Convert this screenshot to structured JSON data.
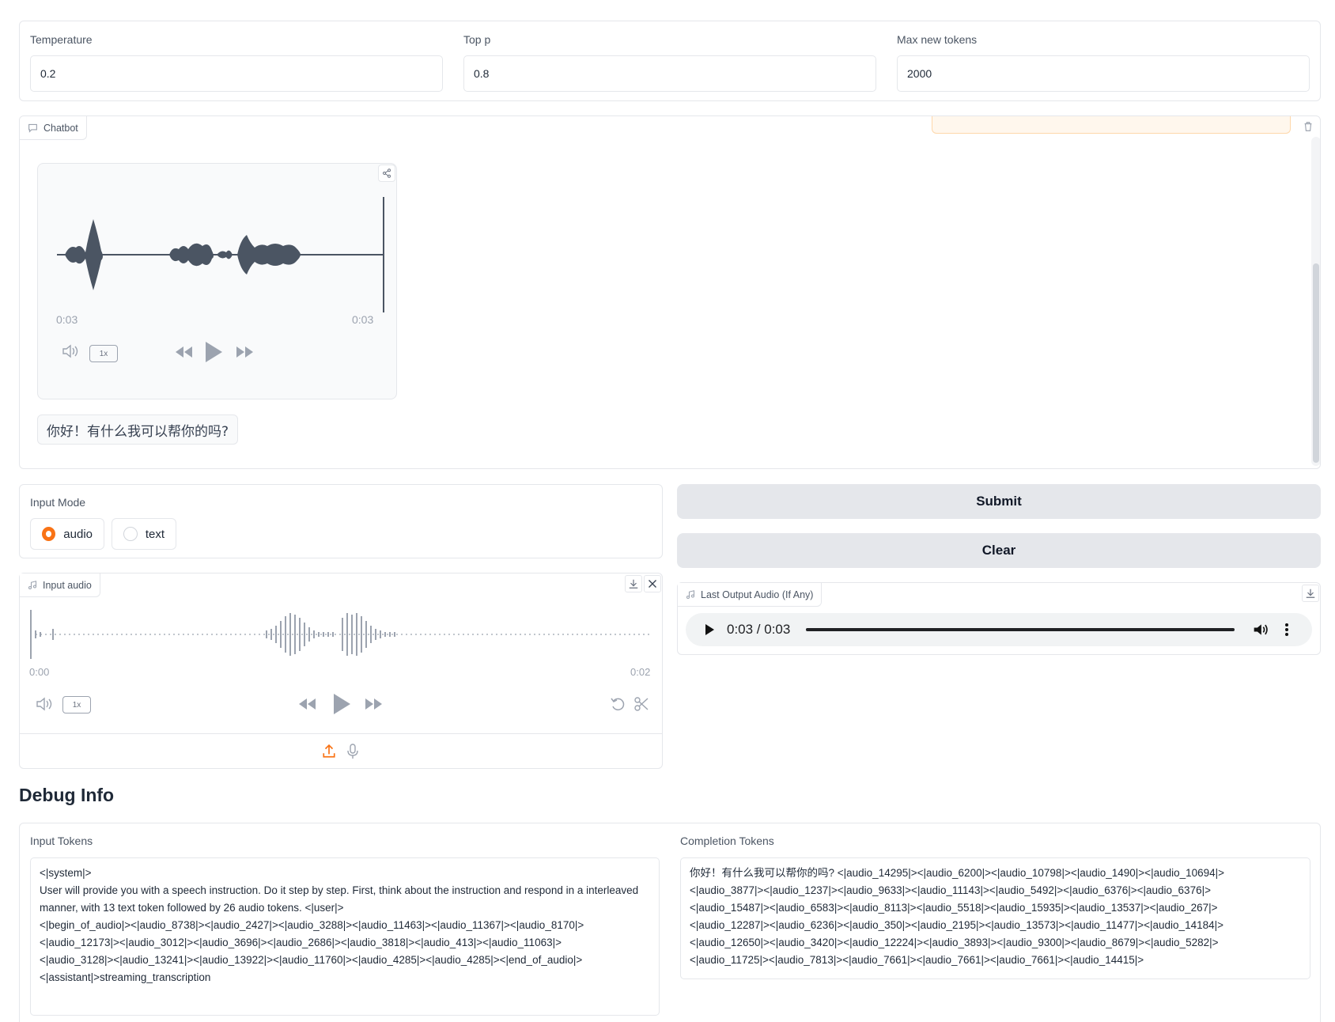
{
  "params": {
    "temperature": {
      "label": "Temperature",
      "value": "0.2"
    },
    "top_p": {
      "label": "Top p",
      "value": "0.8"
    },
    "max_new_tokens": {
      "label": "Max new tokens",
      "value": "2000"
    }
  },
  "chatbot": {
    "label": "Chatbot",
    "audio_message": {
      "time_current": "0:03",
      "time_total": "0:03",
      "speed": "1x"
    },
    "text_message": "你好！有什么我可以帮你的吗?"
  },
  "input_mode": {
    "label": "Input Mode",
    "options": [
      {
        "label": "audio",
        "selected": true
      },
      {
        "label": "text",
        "selected": false
      }
    ]
  },
  "input_audio": {
    "label": "Input audio",
    "time_start": "0:00",
    "time_end": "0:02",
    "speed": "1x"
  },
  "buttons": {
    "submit": "Submit",
    "clear": "Clear"
  },
  "output_audio": {
    "label": "Last Output Audio (If Any)",
    "time": "0:03 / 0:03",
    "progress": 1.0
  },
  "debug": {
    "title": "Debug Info",
    "input_tokens": {
      "label": "Input Tokens",
      "text": "<|system|>\nUser will provide you with a speech instruction. Do it step by step. First, think about the instruction and respond in a interleaved manner, with 13 text token followed by 26 audio tokens. <|user|>\n<|begin_of_audio|><|audio_8738|><|audio_2427|><|audio_3288|><|audio_11463|><|audio_11367|><|audio_8170|>\n<|audio_12173|><|audio_3012|><|audio_3696|><|audio_2686|><|audio_3818|><|audio_413|><|audio_11063|>\n<|audio_3128|><|audio_13241|><|audio_13922|><|audio_11760|><|audio_4285|><|audio_4285|><|end_of_audio|>\n<|assistant|>streaming_transcription"
    },
    "completion_tokens": {
      "label": "Completion Tokens",
      "text": "你好！有什么我可以帮你的吗? <|audio_14295|><|audio_6200|><|audio_10798|><|audio_1490|><|audio_10694|>\n<|audio_3877|><|audio_1237|><|audio_9633|><|audio_11143|><|audio_5492|><|audio_6376|><|audio_6376|>\n<|audio_15487|><|audio_6583|><|audio_8113|><|audio_5518|><|audio_15935|><|audio_13537|><|audio_267|>\n<|audio_12287|><|audio_6236|><|audio_350|><|audio_2195|><|audio_13573|><|audio_11477|><|audio_14184|>\n<|audio_12650|><|audio_3420|><|audio_12224|><|audio_3893|><|audio_9300|><|audio_8679|><|audio_5282|>\n<|audio_11725|><|audio_7813|><|audio_7661|><|audio_7661|><|audio_7661|><|audio_14415|>"
    }
  }
}
